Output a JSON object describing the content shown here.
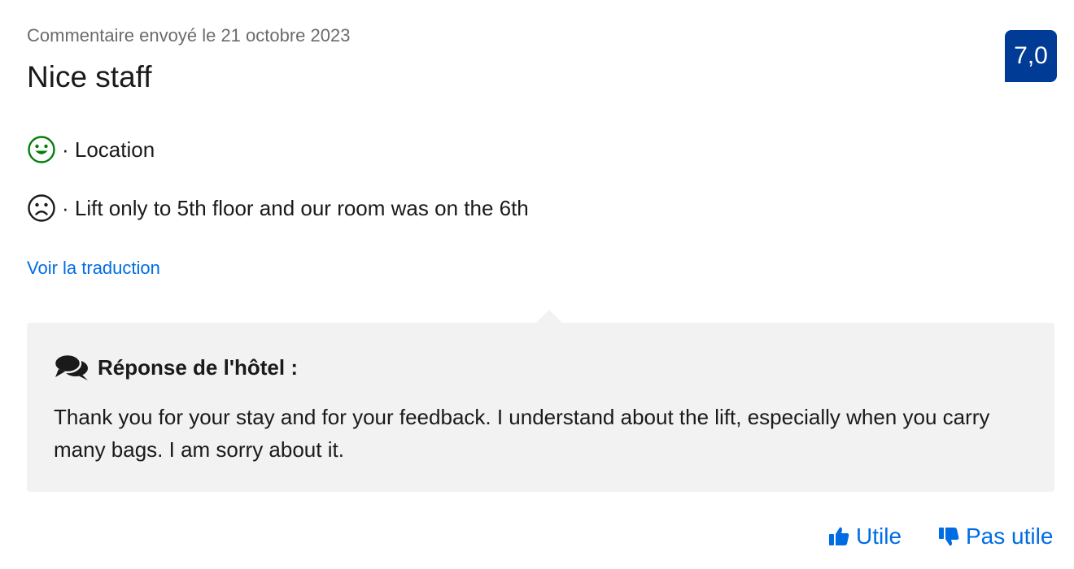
{
  "review": {
    "date": "Commentaire envoyé le 21 octobre 2023",
    "title": "Nice staff",
    "score": "7,0",
    "positive": {
      "icon": "smiley-happy-icon",
      "text": "· Location",
      "color": "#008009"
    },
    "negative": {
      "icon": "smiley-sad-icon",
      "text": "· Lift only to 5th floor and our room was on the 6th",
      "color": "#1a1a1a"
    },
    "translate_link": "Voir la traduction"
  },
  "hotel_reply": {
    "icon": "speech-bubbles-icon",
    "title": "Réponse de l'hôtel :",
    "text": "Thank you for your stay and for your feedback. I understand about the lift, especially when you carry many bags. I am sorry about it."
  },
  "votes": {
    "helpful": {
      "icon": "thumbs-up-icon",
      "label": "Utile"
    },
    "not_helpful": {
      "icon": "thumbs-down-icon",
      "label": "Pas utile"
    }
  },
  "colors": {
    "score_badge_bg": "#003b95",
    "link": "#006ce4",
    "reply_bg": "#f2f2f2",
    "muted_text": "#6b6b6b"
  }
}
